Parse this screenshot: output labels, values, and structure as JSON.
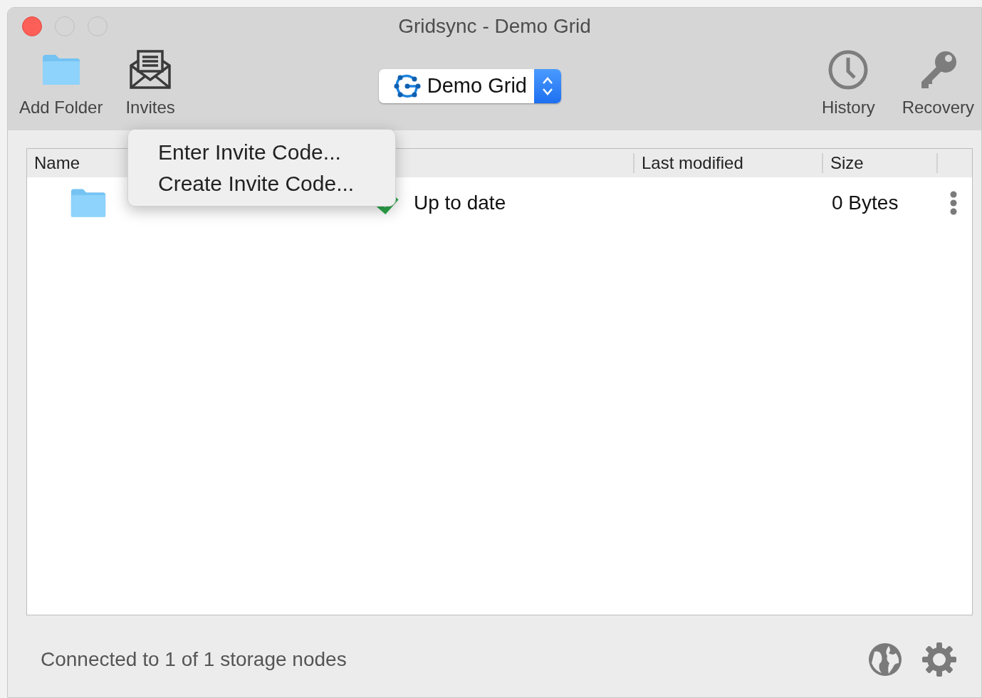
{
  "window": {
    "title": "Gridsync - Demo Grid"
  },
  "toolbar": {
    "left": [
      {
        "label": "Add Folder",
        "kind": "folder"
      },
      {
        "label": "Invites",
        "kind": "envelope"
      }
    ],
    "grid_selector": {
      "value": "Demo Grid"
    },
    "right": [
      {
        "label": "History",
        "kind": "clock"
      },
      {
        "label": "Recovery",
        "kind": "key"
      }
    ]
  },
  "invites_menu": {
    "items": [
      "Enter Invite Code...",
      "Create Invite Code..."
    ]
  },
  "table": {
    "columns": [
      {
        "kind": "name",
        "label": "Name"
      },
      {
        "kind": "status"
      },
      {
        "kind": "modified",
        "label": "Last modified"
      },
      {
        "kind": "size",
        "label": "Size"
      },
      {
        "kind": "actions"
      }
    ],
    "rows": [
      {
        "status": "Up to date",
        "synced": true,
        "size": "0 Bytes"
      }
    ]
  },
  "status_bar": {
    "text": "Connected to 1 of 1 storage nodes"
  }
}
